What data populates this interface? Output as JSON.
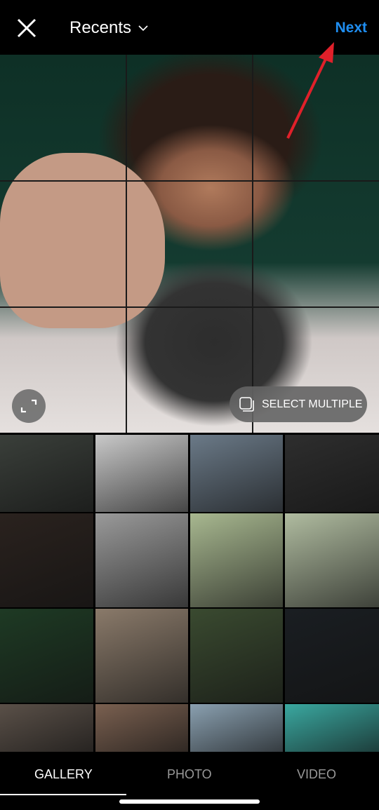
{
  "header": {
    "title": "Recents",
    "next_label": "Next",
    "close_icon": "close-icon",
    "dropdown_icon": "chevron-down-icon",
    "next_color": "#1f8ef1"
  },
  "preview": {
    "select_multiple_label": "SELECT MULTIPLE",
    "expand_icon": "expand-icon",
    "select_multiple_icon": "stack-icon"
  },
  "annotation": {
    "arrow_color": "#e0202a"
  },
  "tabs": [
    {
      "label": "GALLERY",
      "active": true
    },
    {
      "label": "PHOTO",
      "active": false
    },
    {
      "label": "VIDEO",
      "active": false
    }
  ],
  "thumbnails": [
    {
      "color": "#3a3f3a"
    },
    {
      "color": "#c9c9c9"
    },
    {
      "color": "#6b7a88"
    },
    {
      "color": "#2e2e2e"
    },
    {
      "color": "#2a221e"
    },
    {
      "color": "#9a9a9a"
    },
    {
      "color": "#a8b890"
    },
    {
      "color": "#b0bca0"
    },
    {
      "color": "#1e3a24"
    },
    {
      "color": "#8a7a6a"
    },
    {
      "color": "#3a4a30"
    },
    {
      "color": "#1a1e22"
    },
    {
      "color": "#5a5048"
    },
    {
      "color": "#7a6050"
    },
    {
      "color": "#8aa0b0"
    },
    {
      "color": "#3aa8a0"
    }
  ]
}
